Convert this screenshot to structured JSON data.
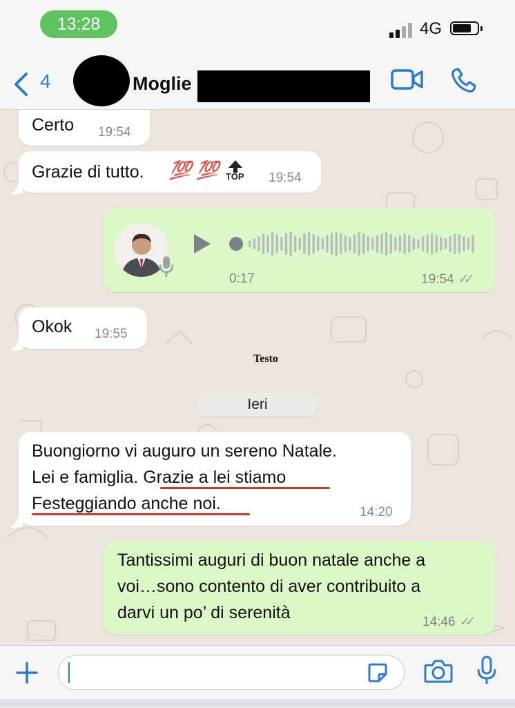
{
  "status_bar": {
    "time": "13:28",
    "network": "4G"
  },
  "header": {
    "back_count": "4",
    "contact_name": "Moglie"
  },
  "messages": [
    {
      "text": "Certo",
      "time": "19:54"
    },
    {
      "text": "Grazie di tutto.",
      "emojis": "💯 💯",
      "time": "19:54"
    },
    {
      "duration": "0:17",
      "time": "19:54"
    },
    {
      "text": "Okok",
      "time": "19:55"
    },
    {
      "line1": "Buongiorno vi auguro un sereno Natale.",
      "line2_plain": "Lei e famiglia. ",
      "line2_underlined": "Grazie a lei stiamo",
      "line3_underlined": "Festeggiando anche noi",
      "line3_end": ".",
      "time": "14:20"
    },
    {
      "line1": "Tantissimi auguri di buon natale anche a",
      "line2": "voi…sono contento di aver contribuito a",
      "line3": "darvi un po’ di serenità",
      "time": "14:46"
    }
  ],
  "caption": "Testo",
  "date_separator": "Ieri",
  "top_badge": "TOP",
  "colors": {
    "accent": "#2a7bd3",
    "incoming": "#ffffff",
    "outgoing": "#dcf8c6",
    "underline": "#d4362a",
    "status_pill": "#5fc35f"
  }
}
